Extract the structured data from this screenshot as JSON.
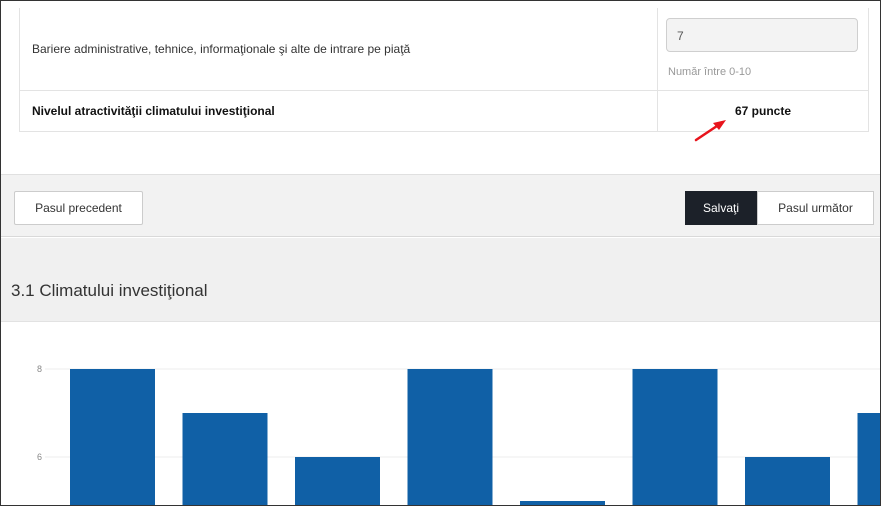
{
  "table": {
    "rows": [
      {
        "label": "Bariere administrative, tehnice, informaţionale şi alte de intrare pe piaţă",
        "input_value": "7",
        "help_text": "Număr între 0-10"
      }
    ],
    "total": {
      "label": "Nivelul atractivităţii climatului investiţional",
      "value": "67 puncte"
    }
  },
  "annotation": {
    "arrow_color": "#e8141c"
  },
  "nav": {
    "prev_label": "Pasul precedent",
    "save_label": "Salvaţi",
    "next_label": "Pasul următor"
  },
  "section": {
    "title": "3.1 Climatului investiţional"
  },
  "chart_data": {
    "type": "bar",
    "series": [
      {
        "values": [
          8,
          7,
          6,
          8,
          5,
          8,
          6,
          7
        ],
        "color": "#1060a6"
      }
    ],
    "y_ticks": [
      "8",
      "6"
    ],
    "ylim_visible": [
      4.9,
      8.2
    ],
    "grid": true
  }
}
